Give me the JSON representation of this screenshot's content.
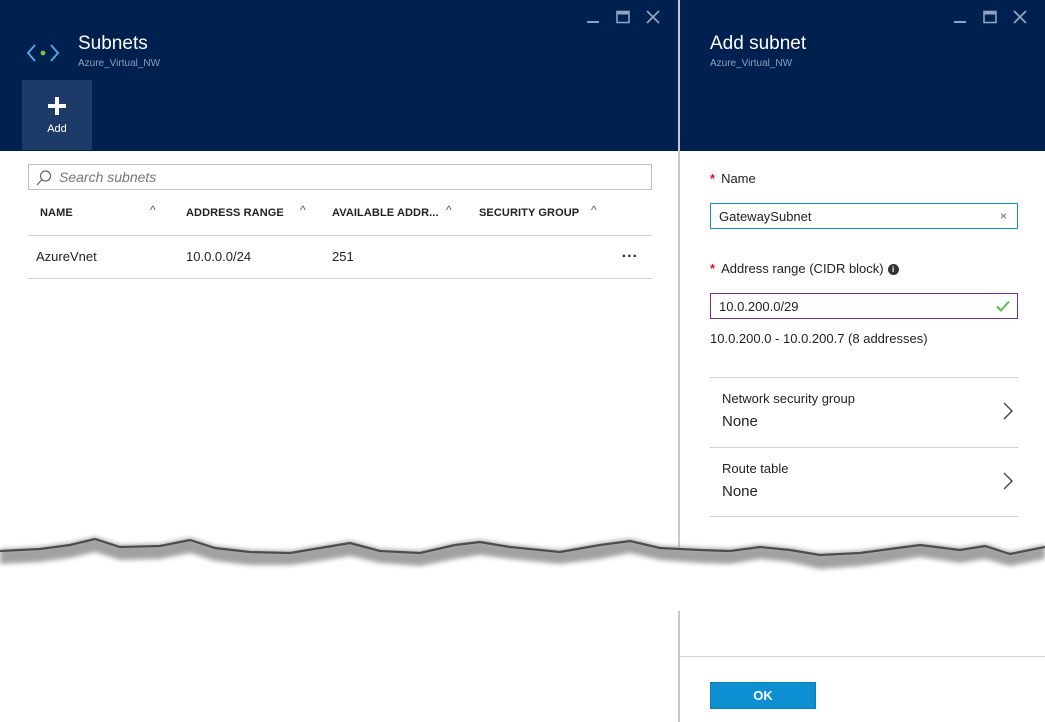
{
  "left_blade": {
    "title": "Subnets",
    "subtitle": "Azure_Virtual_NW",
    "add_label": "Add",
    "search_placeholder": "Search subnets",
    "columns": [
      "NAME",
      "ADDRESS RANGE",
      "AVAILABLE ADDR...",
      "SECURITY GROUP"
    ],
    "rows": [
      {
        "name": "AzureVnet",
        "address_range": "10.0.0.0/24",
        "available": "251",
        "security_group": "",
        "more": "..."
      }
    ]
  },
  "right_blade": {
    "title": "Add subnet",
    "subtitle": "Azure_Virtual_NW",
    "name_label": "Name",
    "name_value": "GatewaySubnet",
    "address_label": "Address range (CIDR block)",
    "address_value": "10.0.200.0/29",
    "address_hint": "10.0.200.0 - 10.0.200.7 (8 addresses)",
    "pickers": [
      {
        "label": "Network security group",
        "value": "None"
      },
      {
        "label": "Route table",
        "value": "None"
      }
    ],
    "ok_label": "OK"
  },
  "required_mark": "*",
  "info_glyph": "i",
  "clear_glyph": "×",
  "sort_glyph": "^",
  "colors": {
    "header_bg": "#002050",
    "command_bg": "#1e3a68",
    "accent_blue": "#0d8fd1",
    "valid_border": "#7a2e8f",
    "required_red": "#e81123",
    "valid_green": "#5cb85c"
  },
  "icons": [
    "vnet-icon",
    "minimize-icon",
    "maximize-icon",
    "close-icon",
    "plus-icon",
    "search-icon",
    "sort-icon",
    "more-icon",
    "info-icon",
    "clear-icon",
    "checkmark-icon",
    "chevron-right-icon"
  ]
}
